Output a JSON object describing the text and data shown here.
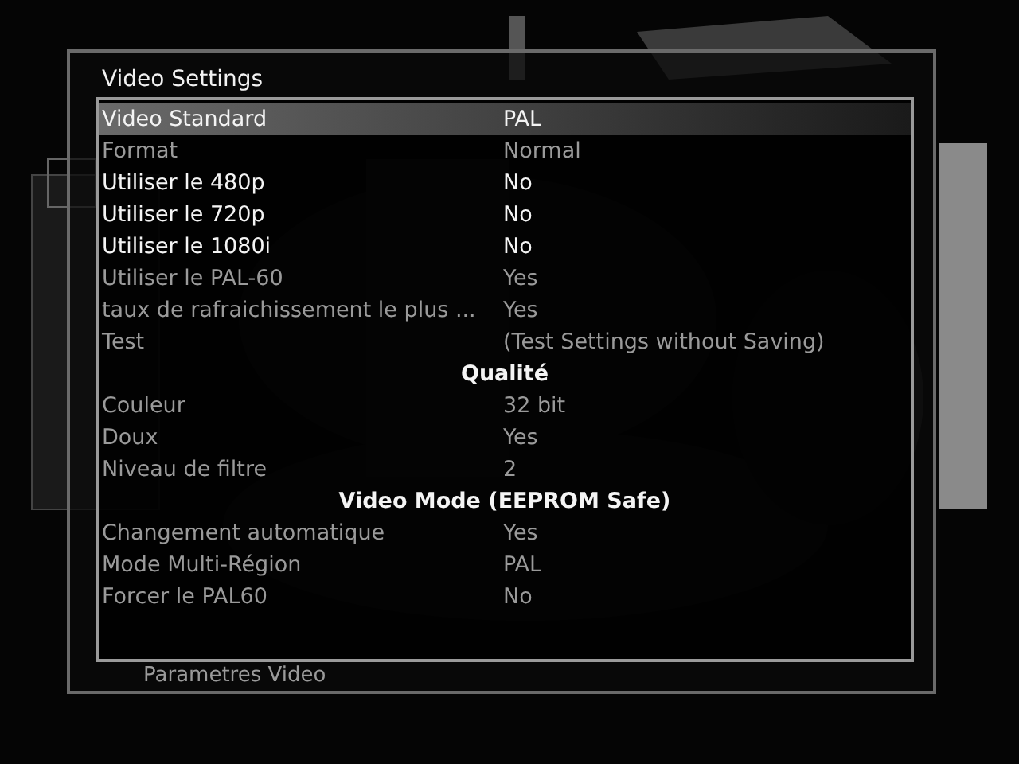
{
  "background": {
    "caption": "Parametres Video"
  },
  "dialog": {
    "title": "Video Settings",
    "items": [
      {
        "kind": "setting",
        "label": "Video Standard",
        "value": "PAL",
        "disabled": false,
        "selected": true
      },
      {
        "kind": "setting",
        "label": "Format",
        "value": "Normal",
        "disabled": true,
        "selected": false
      },
      {
        "kind": "setting",
        "label": "Utiliser le 480p",
        "value": "No",
        "disabled": false,
        "selected": false
      },
      {
        "kind": "setting",
        "label": "Utiliser le 720p",
        "value": "No",
        "disabled": false,
        "selected": false
      },
      {
        "kind": "setting",
        "label": "Utiliser le 1080i",
        "value": "No",
        "disabled": false,
        "selected": false
      },
      {
        "kind": "setting",
        "label": "Utiliser le PAL-60",
        "value": "Yes",
        "disabled": true,
        "selected": false
      },
      {
        "kind": "setting",
        "label": "taux de rafraichissement le plus ...",
        "value": "Yes",
        "disabled": true,
        "selected": false
      },
      {
        "kind": "setting",
        "label": "Test",
        "value": "(Test Settings without Saving)",
        "disabled": true,
        "selected": false
      },
      {
        "kind": "header",
        "label": "Qualité"
      },
      {
        "kind": "setting",
        "label": "Couleur",
        "value": "32 bit",
        "disabled": true,
        "selected": false
      },
      {
        "kind": "setting",
        "label": "Doux",
        "value": "Yes",
        "disabled": true,
        "selected": false
      },
      {
        "kind": "setting",
        "label": "Niveau de  filtre",
        "value": "2",
        "disabled": true,
        "selected": false
      },
      {
        "kind": "header",
        "label": "Video Mode (EEPROM Safe)"
      },
      {
        "kind": "setting",
        "label": "Changement automatique",
        "value": "Yes",
        "disabled": true,
        "selected": false
      },
      {
        "kind": "setting",
        "label": "Mode Multi-Région",
        "value": "PAL",
        "disabled": true,
        "selected": false
      },
      {
        "kind": "setting",
        "label": "Forcer le PAL60",
        "value": "No",
        "disabled": true,
        "selected": false
      }
    ]
  }
}
